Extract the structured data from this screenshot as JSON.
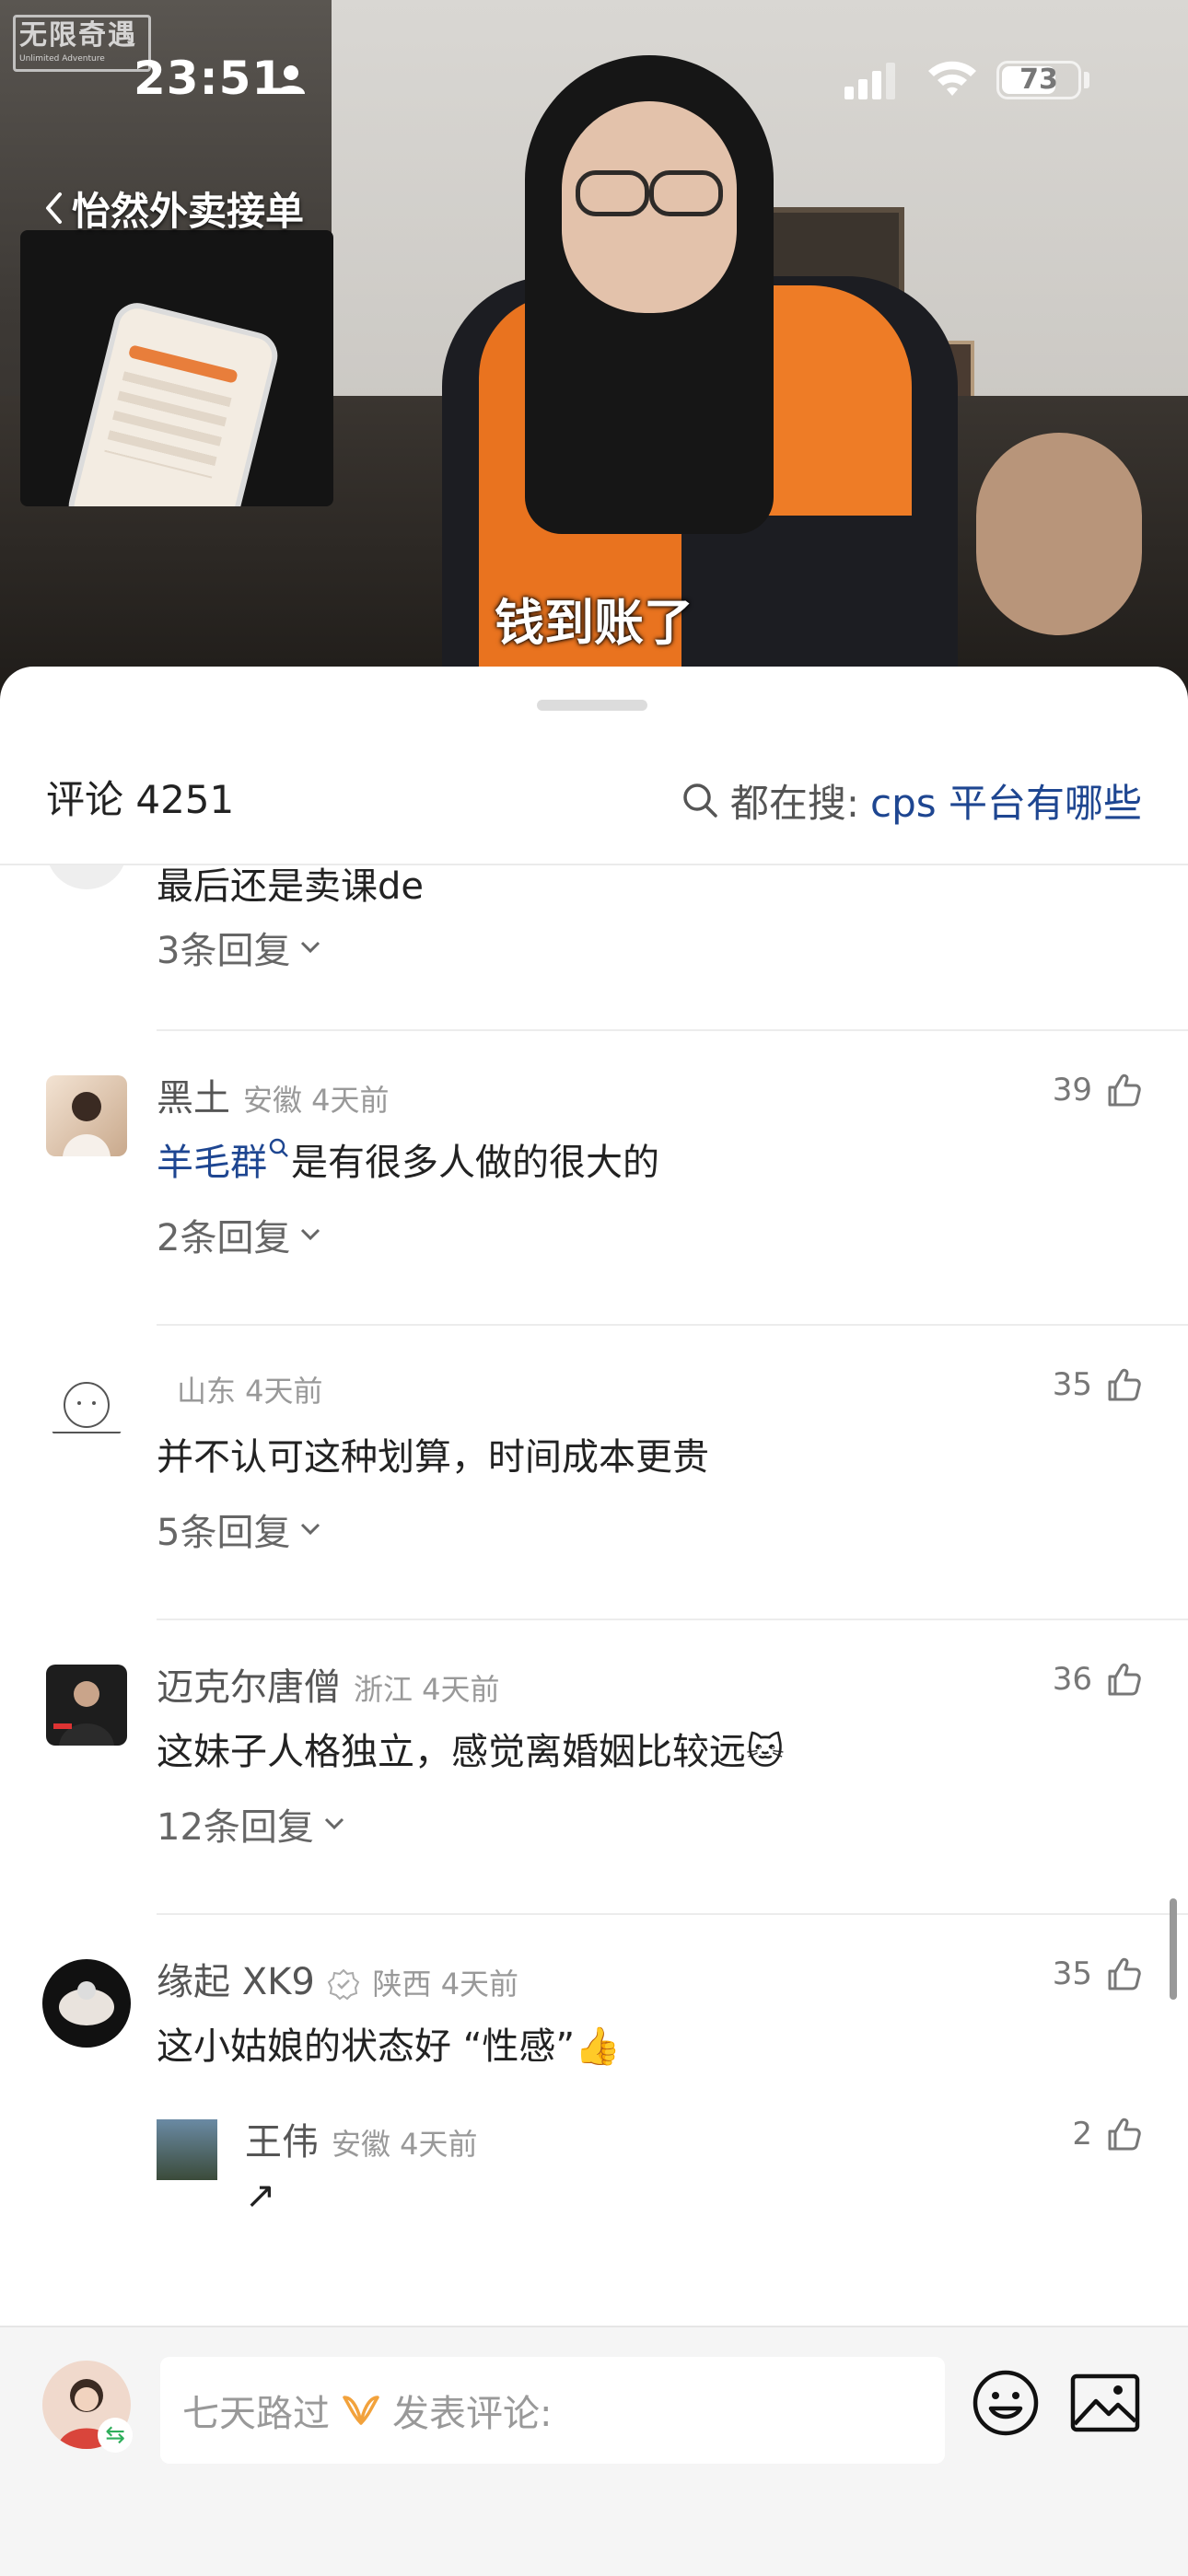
{
  "status_bar": {
    "time": "23:51",
    "battery": "73",
    "battery_level": 0.73
  },
  "video": {
    "watermark_logo": "无限奇遇",
    "watermark_sub": "Unlimited Adventure",
    "back_title": "怡然外卖接单",
    "subtitle": "钱到账了"
  },
  "comments_header": {
    "count_label": "评论 4251",
    "search_label": "都在搜:",
    "search_query": "cps 平台有哪些"
  },
  "comments": [
    {
      "text": "最后还是卖课de",
      "replies": "3条回复"
    },
    {
      "username": "黑土",
      "meta": "安徽 4天前",
      "likes": "39",
      "mention": "羊毛群",
      "text": "是有很多人做的很大的",
      "replies": "2条回复"
    },
    {
      "username": "",
      "meta": "山东 4天前",
      "likes": "35",
      "text": "并不认可这种划算，时间成本更贵",
      "replies": "5条回复"
    },
    {
      "username": "迈克尔唐僧",
      "meta": "浙江 4天前",
      "likes": "36",
      "text": "这妹子人格独立，感觉离婚姻比较远",
      "emoji": "🐱",
      "replies": "12条回复"
    },
    {
      "username": "缘起 XK9",
      "meta": "陕西 4天前",
      "likes": "35",
      "text": "这小姑娘的状态好 “性感”",
      "emoji": "👍",
      "sub_reply": {
        "username": "王伟",
        "meta": "安徽 4天前",
        "likes": "2",
        "text": "↗"
      }
    }
  ],
  "bottom_bar": {
    "placeholder_name": "七天路过",
    "placeholder_action": "发表评论:"
  },
  "colors": {
    "accent_blue": "#1e4691",
    "text_primary": "#222222",
    "text_secondary": "#999999",
    "sheet_bg": "#ffffff",
    "bar_bg": "#f5f5f5"
  }
}
